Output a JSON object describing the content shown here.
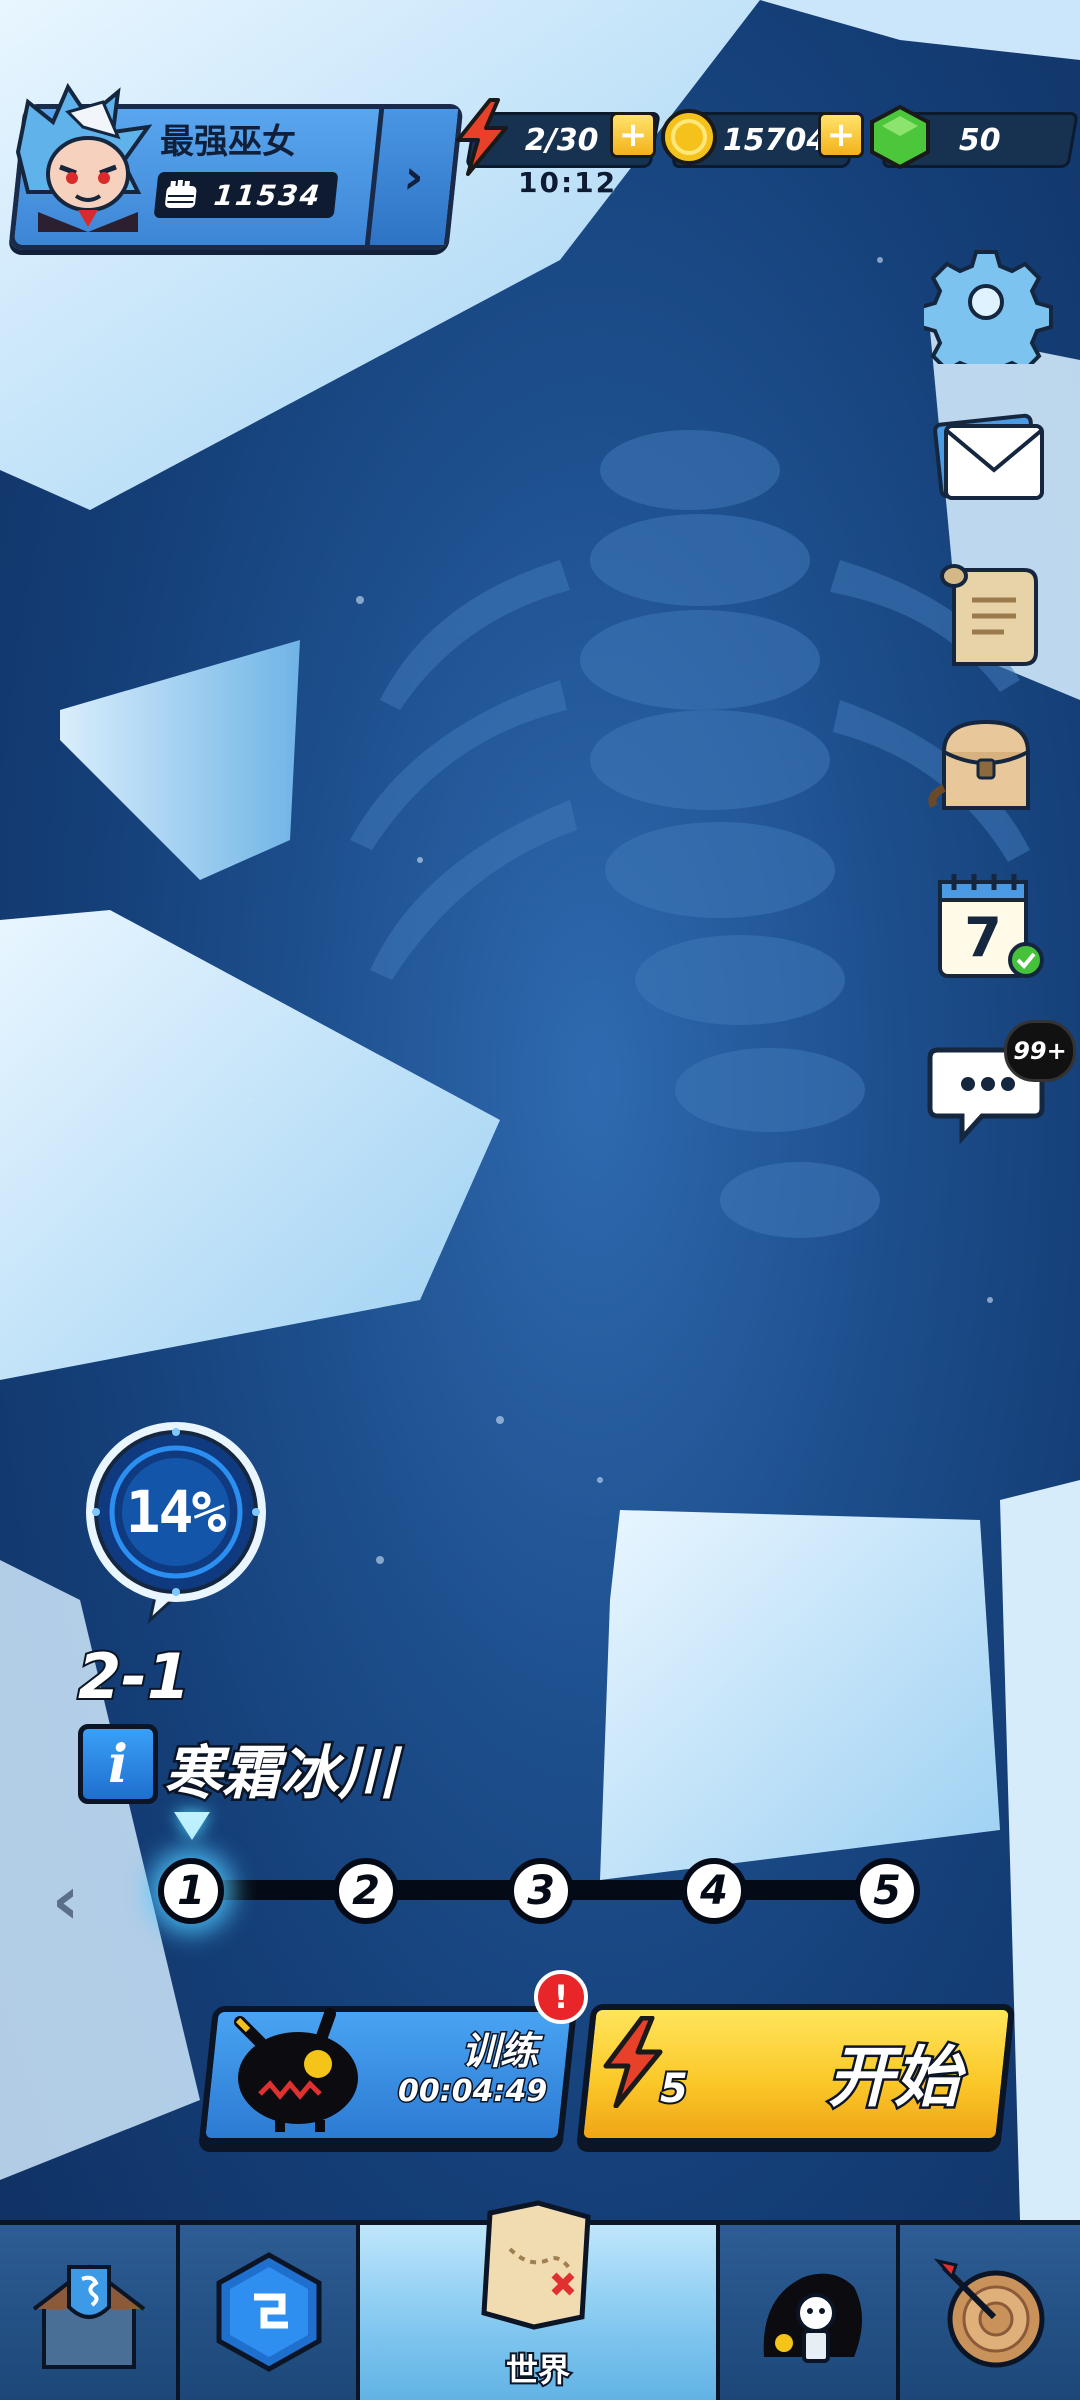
{
  "player": {
    "nickname": "最强巫女",
    "power": "11534"
  },
  "resources": {
    "energy": "2/30",
    "energy_timer": "10:12",
    "gold": "15704",
    "gems": "50"
  },
  "side_menu": {
    "settings_icon": "gear-icon",
    "mail_icon": "envelope-icon",
    "quest_icon": "scroll-icon",
    "bag_icon": "backpack-icon",
    "checkin_day": "7",
    "chat_badge": "99+"
  },
  "stage": {
    "progress": "14%",
    "code": "2-1",
    "name": "寒霜冰川",
    "info_label": "i",
    "nodes": [
      "1",
      "2",
      "3",
      "4",
      "5"
    ],
    "active_node": "1",
    "prev_arrow": "‹"
  },
  "actions": {
    "train_label": "训练",
    "train_timer": "00:04:49",
    "alert": "!",
    "start_label": "开始",
    "start_cost": "5"
  },
  "nav": {
    "tabs": [
      {
        "id": "guild",
        "icon": "shield-house-icon",
        "label": ""
      },
      {
        "id": "rune",
        "icon": "rune-gem-icon",
        "label": ""
      },
      {
        "id": "world",
        "icon": "treasure-map-icon",
        "label": "世界"
      },
      {
        "id": "heroes",
        "icon": "heroes-icon",
        "label": ""
      },
      {
        "id": "arena",
        "icon": "target-icon",
        "label": ""
      }
    ]
  },
  "colors": {
    "accent_blue": "#3d86d6",
    "start_yellow": "#fbc92a",
    "energy_red": "#e8412a",
    "gold": "#f5c21c",
    "gem_green": "#4cc63a"
  }
}
